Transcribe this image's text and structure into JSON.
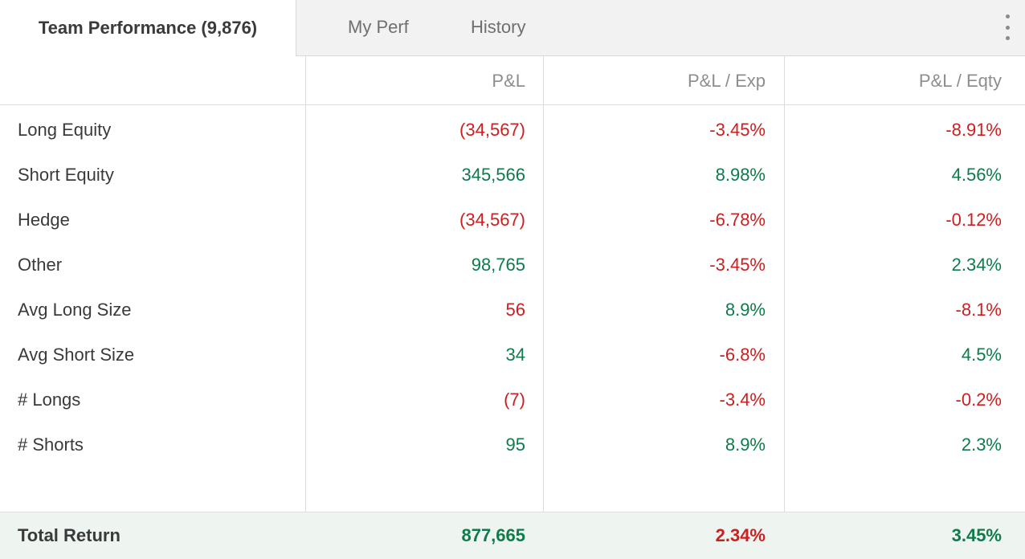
{
  "tabs": {
    "active_label": "Team Performance (9,876)",
    "my_perf_label": "My Perf",
    "history_label": "History"
  },
  "columns": {
    "pnl": "P&L",
    "pnl_exp": "P&L / Exp",
    "pnl_eqty": "P&L / Eqty"
  },
  "rows": [
    {
      "label": "Long Equity",
      "pnl": "(34,567)",
      "pnl_exp": "-3.45%",
      "pnl_eqty": "-8.91%"
    },
    {
      "label": "Short Equity",
      "pnl": "345,566",
      "pnl_exp": "8.98%",
      "pnl_eqty": "4.56%"
    },
    {
      "label": "Hedge",
      "pnl": "(34,567)",
      "pnl_exp": "-6.78%",
      "pnl_eqty": "-0.12%"
    },
    {
      "label": "Other",
      "pnl": "98,765",
      "pnl_exp": "-3.45%",
      "pnl_eqty": "2.34%"
    },
    {
      "label": "Avg Long Size",
      "pnl": "56",
      "pnl_exp": "8.9%",
      "pnl_eqty": "-8.1%"
    },
    {
      "label": "Avg Short Size",
      "pnl": "34",
      "pnl_exp": "-6.8%",
      "pnl_eqty": "4.5%"
    },
    {
      "label": "# Longs",
      "pnl": "(7)",
      "pnl_exp": "-3.4%",
      "pnl_eqty": "-0.2%"
    },
    {
      "label": "# Shorts",
      "pnl": "95",
      "pnl_exp": "8.9%",
      "pnl_eqty": "2.3%"
    }
  ],
  "row_tones": [
    [
      "neg",
      "neg",
      "neg"
    ],
    [
      "pos",
      "pos",
      "pos"
    ],
    [
      "neg",
      "neg",
      "neg"
    ],
    [
      "pos",
      "neg",
      "pos"
    ],
    [
      "neg",
      "pos",
      "neg"
    ],
    [
      "pos",
      "neg",
      "pos"
    ],
    [
      "neg",
      "neg",
      "neg"
    ],
    [
      "pos",
      "pos",
      "pos"
    ]
  ],
  "total": {
    "label": "Total Return",
    "pnl": "877,665",
    "pnl_exp": "2.34%",
    "pnl_eqty": "3.45%",
    "tones": [
      "pos",
      "neg",
      "pos"
    ]
  },
  "colors": {
    "negative": "#cc1f1f",
    "positive": "#0f7a4a",
    "total_row_bg": "#eef5f1",
    "tab_bar_bg": "#f2f2f2"
  },
  "icons": {
    "menu": "kebab-menu-icon"
  }
}
